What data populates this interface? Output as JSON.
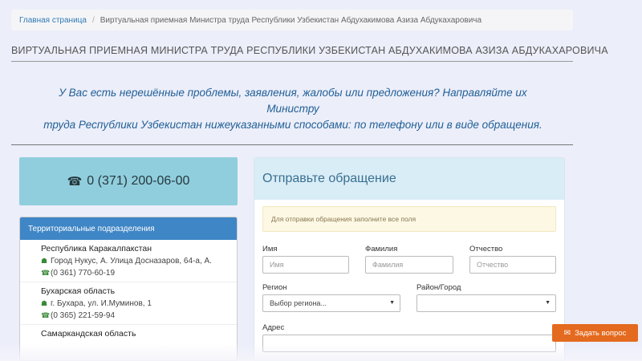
{
  "breadcrumb": {
    "home": "Главная страница",
    "separator": "/",
    "current": "Виртуальная приемная Министра труда Республики Узбекистан Абдухакимова Азиза Абдукахаровича"
  },
  "page_title": "ВИРТУАЛЬНАЯ ПРИЕМНАЯ МИНИСТРА ТРУДА РЕСПУБЛИКИ УЗБЕКИСТАН АБДУХАКИМОВА АЗИЗА АБДУКАХАРОВИЧА",
  "intro": {
    "line1": "У Вас есть нерешённые проблемы, заявления, жалобы или предложения? Направляйте их Министру",
    "line2": "труда Республики Узбекистан нижеуказанными способами: по телефону или в виде обращения."
  },
  "phone": {
    "icon": "phone-icon",
    "number": "0 (371) 200-06-00"
  },
  "territorial": {
    "header": "Территориальные подразделения",
    "regions": [
      {
        "name": "Республика Каракалпакстан",
        "address": "Город Нукус, А. Улица Досназаров, 64-а, А.",
        "phone": "(0 361) 770-60-19"
      },
      {
        "name": "Бухарская область",
        "address": "г. Бухара, ул. И.Муминов, 1",
        "phone": "(0 365) 221-59-94"
      },
      {
        "name": "Самаркандская область",
        "address": "",
        "phone": ""
      }
    ]
  },
  "form": {
    "title": "Отправьте обращение",
    "alert": "Для отправки обращения заполните все поля",
    "fields": {
      "first_name": {
        "label": "Имя",
        "placeholder": "Имя"
      },
      "last_name": {
        "label": "Фамилия",
        "placeholder": "Фамилия"
      },
      "patronymic": {
        "label": "Отчество",
        "placeholder": "Отчество"
      },
      "region": {
        "label": "Регион",
        "value": "Выбор региона..."
      },
      "district": {
        "label": "Район/Город",
        "value": ""
      },
      "address": {
        "label": "Адрес"
      }
    }
  },
  "ask_button": {
    "label": "Задать вопрос",
    "icon": "envelope-icon"
  },
  "colors": {
    "accent_blue": "#3f86c6",
    "phone_box": "#90cedd",
    "ask_button": "#e46a1f",
    "alert_bg": "#fcf8e3"
  }
}
